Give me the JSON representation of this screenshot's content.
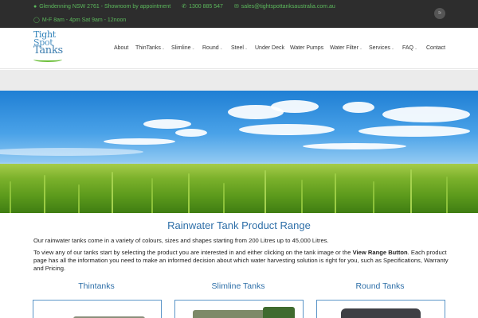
{
  "topbar": {
    "address": "Glendenning NSW 2761 - Showroom by appointment",
    "phone": "1300 885 547",
    "email": "sales@tightspottanksaustralia.com.au",
    "hours": "M-F 8am - 4pm Sat 9am - 12noon"
  },
  "logo": {
    "line1": "Tight",
    "line2": "Spot",
    "line3": "Tanks"
  },
  "nav": {
    "items": [
      {
        "label": "About",
        "dropdown": false
      },
      {
        "label": "ThinTanks",
        "dropdown": true
      },
      {
        "label": "Slimline",
        "dropdown": true
      },
      {
        "label": "Round",
        "dropdown": true
      },
      {
        "label": "Steel",
        "dropdown": true
      },
      {
        "label": "Under Deck",
        "dropdown": false
      },
      {
        "label": "Water Pumps",
        "dropdown": false
      },
      {
        "label": "Water Filter",
        "dropdown": true
      },
      {
        "label": "Services",
        "dropdown": true
      },
      {
        "label": "FAQ",
        "dropdown": true
      },
      {
        "label": "Contact",
        "dropdown": false
      }
    ]
  },
  "content": {
    "title": "Rainwater Tank Product Range",
    "intro": "Our rainwater tanks come in a variety of colours, sizes and shapes starting from 200 Litres up to 45,000 Litres.",
    "body_before": "To view any of our tanks start by selecting the product you are interested in and either clicking on the tank image or the ",
    "body_bold": "View Range Button",
    "body_after": ". Each product page has all the information you need to make an informed decision about which water harvesting solution is right for you, such as Specifications, Warranty and Pricing."
  },
  "products": [
    {
      "title": "Thintanks"
    },
    {
      "title": "Slimline Tanks"
    },
    {
      "title": "Round Tanks"
    }
  ],
  "colors": {
    "accent": "#2e6fa8",
    "topbar_bg": "#2d2d2d",
    "topbar_text": "#5cb85c",
    "card_border": "#5b95c8"
  },
  "icons": {
    "address": "map-pin-icon",
    "phone": "phone-icon",
    "email": "envelope-icon",
    "hours": "clock-icon",
    "social": "rss-icon"
  }
}
